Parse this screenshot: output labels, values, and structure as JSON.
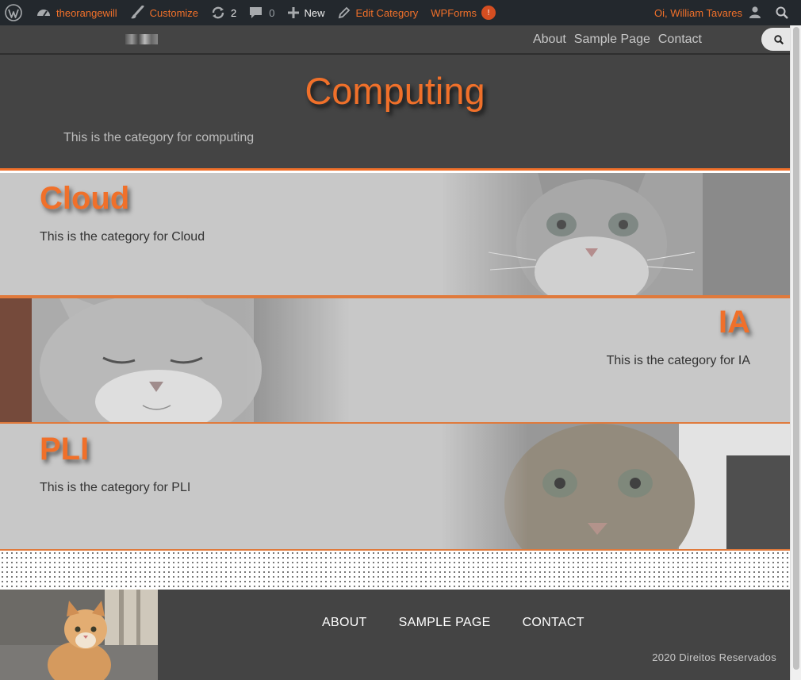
{
  "admin_bar": {
    "site_name": "theorangewill",
    "customize_label": "Customize",
    "updates_count": "2",
    "comments_count": "0",
    "new_label": "New",
    "edit_label": "Edit Category",
    "wpforms_label": "WPForms",
    "wpforms_badge": "!",
    "greeting": "Oi, William Tavares"
  },
  "header": {
    "nav": [
      "About",
      "Sample Page",
      "Contact"
    ]
  },
  "hero": {
    "title": "Computing",
    "description": "This is the category for computing"
  },
  "categories": [
    {
      "name": "Cloud",
      "description": "This is the category for Cloud"
    },
    {
      "name": "IA",
      "description": "This is the category for IA"
    },
    {
      "name": "PLI",
      "description": "This is the category for PLI"
    }
  ],
  "footer": {
    "nav": [
      "ABOUT",
      "SAMPLE PAGE",
      "CONTACT"
    ],
    "copyright": "2020 Direitos Reservados"
  },
  "colors": {
    "accent": "#f0702a",
    "admin_bar": "#23282d",
    "dark_bg": "#444444",
    "card_bg": "#c8c8c8"
  }
}
